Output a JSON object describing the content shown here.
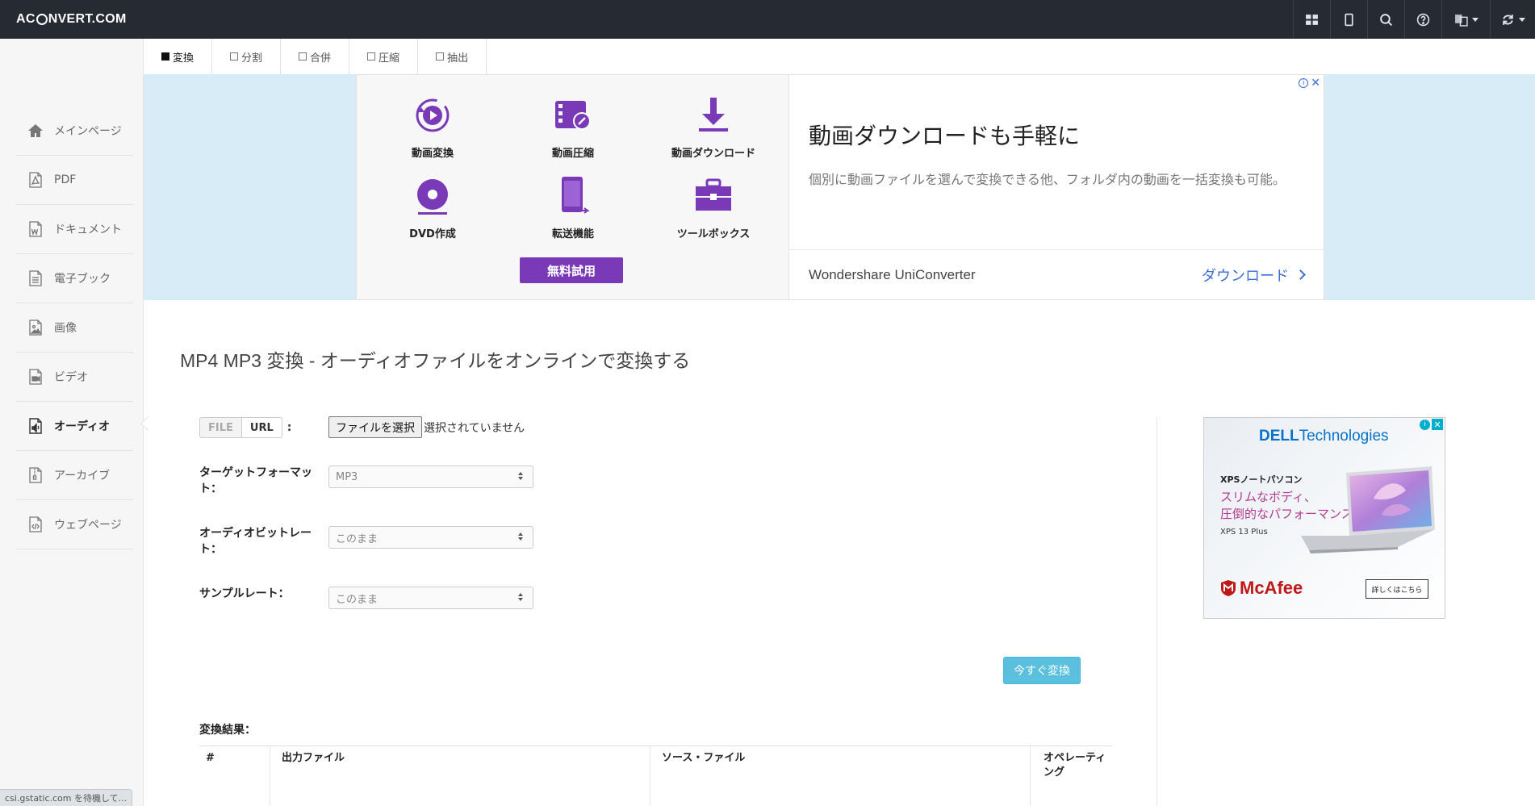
{
  "header": {
    "logo_prefix": "AC",
    "logo_suffix": "NVERT.COM",
    "actions": [
      {
        "icon": "grid-icon"
      },
      {
        "icon": "mobile-icon"
      },
      {
        "icon": "search-icon"
      },
      {
        "icon": "help-icon"
      },
      {
        "icon": "language-icon"
      },
      {
        "icon": "refresh-icon"
      }
    ]
  },
  "tabs": [
    {
      "label": "変換",
      "active": true
    },
    {
      "label": "分割",
      "active": false
    },
    {
      "label": "合併",
      "active": false
    },
    {
      "label": "圧縮",
      "active": false
    },
    {
      "label": "抽出",
      "active": false
    }
  ],
  "sidebar": {
    "items": [
      {
        "label": "メインページ",
        "icon": "home-icon"
      },
      {
        "label": "PDF",
        "icon": "pdf-file-icon"
      },
      {
        "label": "ドキュメント",
        "icon": "word-file-icon"
      },
      {
        "label": "電子ブック",
        "icon": "ebook-file-icon"
      },
      {
        "label": "画像",
        "icon": "image-file-icon"
      },
      {
        "label": "ビデオ",
        "icon": "video-file-icon"
      },
      {
        "label": "オーディオ",
        "icon": "audio-file-icon",
        "active": true
      },
      {
        "label": "アーカイブ",
        "icon": "archive-file-icon"
      },
      {
        "label": "ウェブページ",
        "icon": "code-file-icon"
      }
    ]
  },
  "ad_banner": {
    "features": [
      {
        "label": "動画変換",
        "icon": "video-convert-icon"
      },
      {
        "label": "動画圧縮",
        "icon": "video-compress-icon"
      },
      {
        "label": "動画ダウンロード",
        "icon": "download-icon"
      },
      {
        "label": "DVD作成",
        "icon": "dvd-icon"
      },
      {
        "label": "転送機能",
        "icon": "transfer-icon"
      },
      {
        "label": "ツールボックス",
        "icon": "toolbox-icon"
      }
    ],
    "trial_label": "無料試用",
    "headline": "動画ダウンロードも手軽に",
    "description": "個別に動画ファイルを選んで変換できる他、フォルダ内の動画を一括変換も可能。",
    "brand": "Wondershare UniConverter",
    "download_label": "ダウンロード",
    "accent": "#7a3ab8"
  },
  "page": {
    "title": "MP4 MP3 変換 - オーディオファイルをオンラインで変換する"
  },
  "form": {
    "source_file": "FILE",
    "source_url": "URL",
    "source_colon": ":",
    "choose_file": "ファイルを選択",
    "no_file": "選択されていません",
    "target_format_label": "ターゲットフォーマット：",
    "target_format_value": "MP3",
    "bitrate_label": "オーディオビットレート：",
    "bitrate_value": "このまま",
    "sample_rate_label": "サンプルレート：",
    "sample_rate_value": "このまま",
    "convert_label": "今すぐ変換",
    "convert_color": "#5bc0de"
  },
  "results": {
    "label": "変換結果：",
    "columns": [
      "#",
      "出力ファイル",
      "ソース・ファイル",
      "オペレーティング"
    ]
  },
  "side_ad": {
    "brand_bold": "DELL",
    "brand_rest": "Technologies",
    "product_line": "XPSノートパソコン",
    "tagline_1": "スリムなボディ、",
    "tagline_2": "圧倒的なパフォーマンス。",
    "model": "XPS 13 Plus",
    "partner": "McAfee",
    "cta": "詳しくはこちら"
  },
  "status": {
    "text": "csi.gstatic.com を待機して..."
  }
}
